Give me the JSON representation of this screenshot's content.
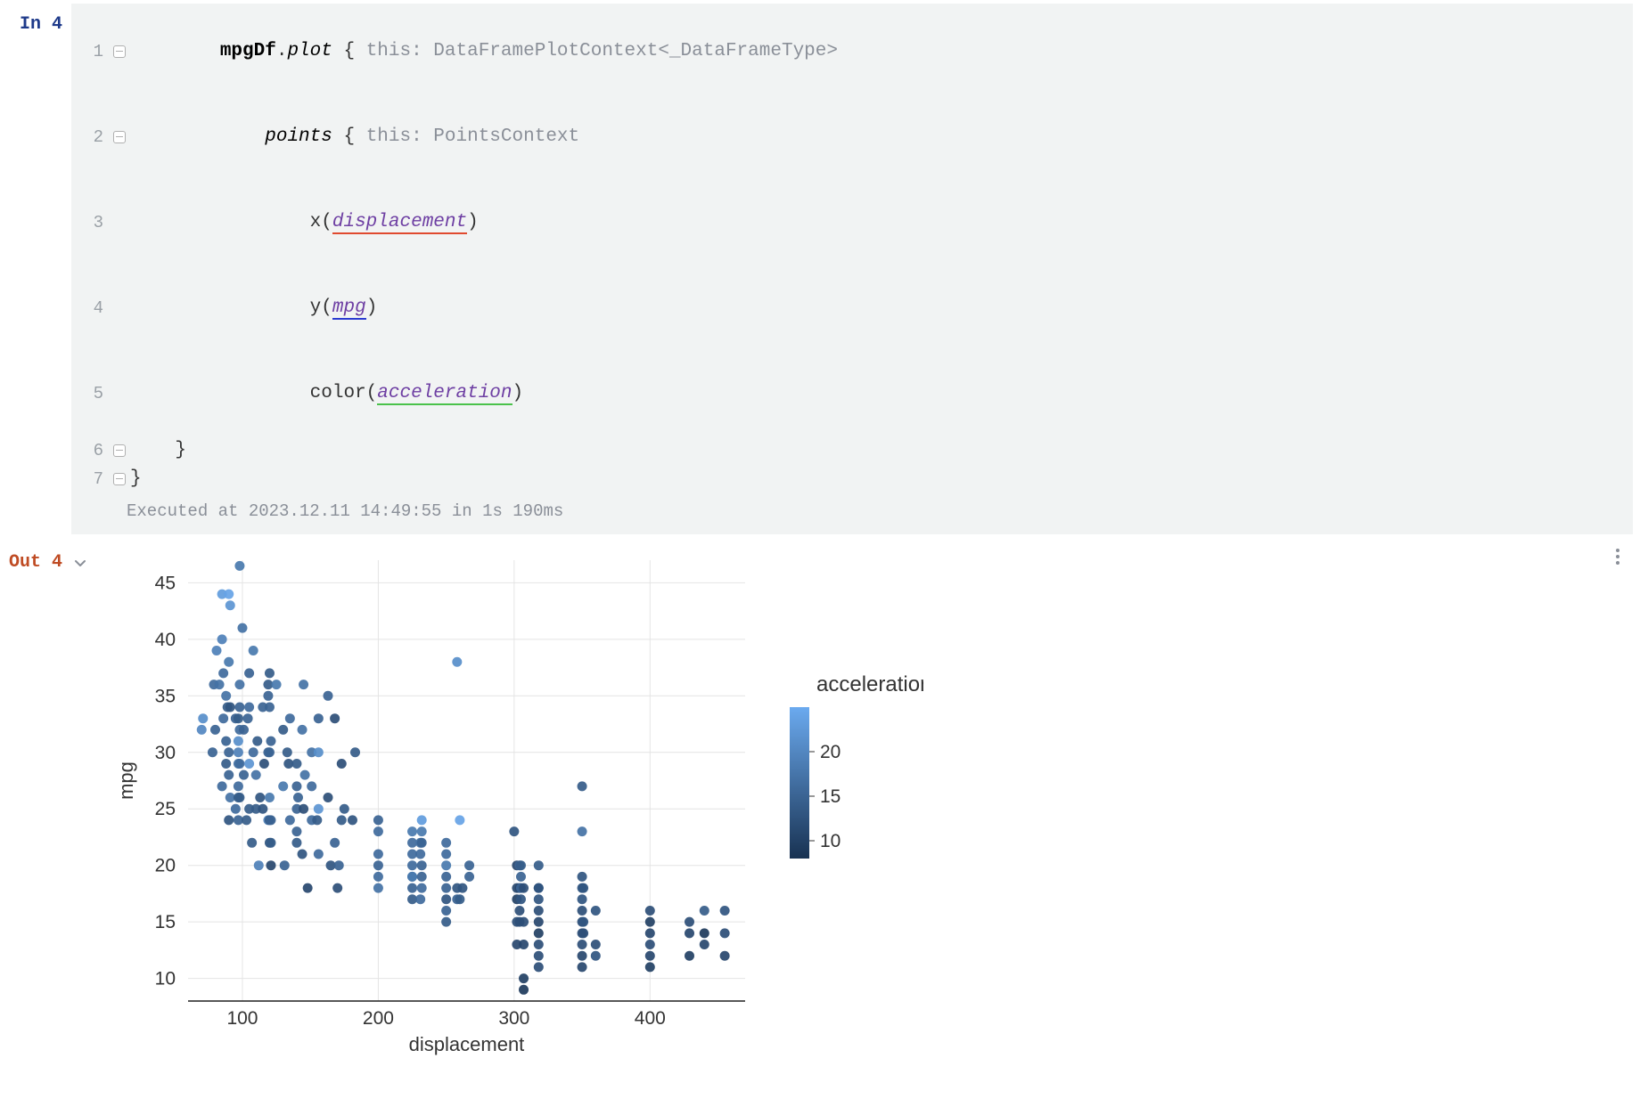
{
  "cell": {
    "in_label": "In 4",
    "out_label": "Out 4",
    "exec_info": "Executed at 2023.12.11 14:49:55 in 1s 190ms",
    "code": {
      "line1_var": "mpgDf",
      "line1_dot": ".",
      "line1_plot": "plot",
      "line1_brace": " { ",
      "line1_hint": "this: DataFramePlotContext<_DataFrameType>",
      "line2_indent": "    ",
      "line2_points": "points",
      "line2_brace": " { ",
      "line2_hint": "this: PointsContext",
      "line3_indent": "        ",
      "line3_pre": "x(",
      "line3_arg": "displacement",
      "line3_post": ")",
      "line4_indent": "        ",
      "line4_pre": "y(",
      "line4_arg": "mpg",
      "line4_post": ")",
      "line5_indent": "        ",
      "line5_pre": "color(",
      "line5_arg": "acceleration",
      "line5_post": ")",
      "line6_indent": "    ",
      "line6": "}",
      "line7": "}"
    },
    "line_numbers": [
      "1",
      "2",
      "3",
      "4",
      "5",
      "6",
      "7"
    ]
  },
  "chart_data": {
    "type": "scatter",
    "xlabel": "displacement",
    "ylabel": "mpg",
    "legend_title": "acceleration",
    "xlim": [
      60,
      470
    ],
    "ylim": [
      8,
      47
    ],
    "x_ticks": [
      100,
      200,
      300,
      400
    ],
    "y_ticks": [
      10,
      15,
      20,
      25,
      30,
      35,
      40,
      45
    ],
    "color_scale_domain": [
      8,
      25
    ],
    "color_scale_range_low": "#183252",
    "color_scale_range_high": "#6baaef",
    "legend_ticks": [
      10,
      15,
      20
    ],
    "points": [
      {
        "x": 98,
        "y": 46.5,
        "c": 18
      },
      {
        "x": 70,
        "y": 32,
        "c": 20
      },
      {
        "x": 71,
        "y": 33,
        "c": 21
      },
      {
        "x": 78,
        "y": 30,
        "c": 15
      },
      {
        "x": 79,
        "y": 36,
        "c": 16
      },
      {
        "x": 80,
        "y": 32,
        "c": 15
      },
      {
        "x": 81,
        "y": 39,
        "c": 19
      },
      {
        "x": 83,
        "y": 36,
        "c": 17
      },
      {
        "x": 85,
        "y": 27,
        "c": 16
      },
      {
        "x": 85,
        "y": 44,
        "c": 23
      },
      {
        "x": 85,
        "y": 40,
        "c": 19
      },
      {
        "x": 86,
        "y": 37,
        "c": 16
      },
      {
        "x": 86,
        "y": 33,
        "c": 16
      },
      {
        "x": 88,
        "y": 29,
        "c": 14
      },
      {
        "x": 88,
        "y": 31,
        "c": 15
      },
      {
        "x": 88,
        "y": 35,
        "c": 17
      },
      {
        "x": 89,
        "y": 34,
        "c": 14
      },
      {
        "x": 90,
        "y": 44,
        "c": 24
      },
      {
        "x": 90,
        "y": 28,
        "c": 15
      },
      {
        "x": 90,
        "y": 30,
        "c": 15
      },
      {
        "x": 90,
        "y": 38,
        "c": 18
      },
      {
        "x": 90,
        "y": 24,
        "c": 13
      },
      {
        "x": 91,
        "y": 26,
        "c": 17
      },
      {
        "x": 91,
        "y": 43,
        "c": 22
      },
      {
        "x": 91,
        "y": 34,
        "c": 13
      },
      {
        "x": 95,
        "y": 25,
        "c": 16
      },
      {
        "x": 95,
        "y": 33,
        "c": 15
      },
      {
        "x": 97,
        "y": 27,
        "c": 16
      },
      {
        "x": 97,
        "y": 29,
        "c": 17
      },
      {
        "x": 97,
        "y": 33,
        "c": 14
      },
      {
        "x": 97,
        "y": 26,
        "c": 14
      },
      {
        "x": 97,
        "y": 31,
        "c": 21
      },
      {
        "x": 97,
        "y": 30,
        "c": 19
      },
      {
        "x": 97,
        "y": 24,
        "c": 15
      },
      {
        "x": 98,
        "y": 36,
        "c": 17
      },
      {
        "x": 98,
        "y": 32,
        "c": 16
      },
      {
        "x": 98,
        "y": 26,
        "c": 14
      },
      {
        "x": 98,
        "y": 29,
        "c": 16
      },
      {
        "x": 98,
        "y": 34,
        "c": 15
      },
      {
        "x": 100,
        "y": 41,
        "c": 17
      },
      {
        "x": 101,
        "y": 28,
        "c": 15
      },
      {
        "x": 101,
        "y": 32,
        "c": 15
      },
      {
        "x": 103,
        "y": 24,
        "c": 14
      },
      {
        "x": 104,
        "y": 33,
        "c": 15
      },
      {
        "x": 105,
        "y": 37,
        "c": 15
      },
      {
        "x": 105,
        "y": 34,
        "c": 16
      },
      {
        "x": 105,
        "y": 29,
        "c": 22
      },
      {
        "x": 105,
        "y": 25,
        "c": 14
      },
      {
        "x": 107,
        "y": 22,
        "c": 14
      },
      {
        "x": 108,
        "y": 30,
        "c": 16
      },
      {
        "x": 108,
        "y": 39,
        "c": 18
      },
      {
        "x": 110,
        "y": 25,
        "c": 14
      },
      {
        "x": 110,
        "y": 28,
        "c": 17
      },
      {
        "x": 111,
        "y": 31,
        "c": 14
      },
      {
        "x": 112,
        "y": 20,
        "c": 19
      },
      {
        "x": 113,
        "y": 26,
        "c": 13
      },
      {
        "x": 115,
        "y": 25,
        "c": 13
      },
      {
        "x": 115,
        "y": 34,
        "c": 15
      },
      {
        "x": 116,
        "y": 29,
        "c": 12
      },
      {
        "x": 119,
        "y": 36,
        "c": 14
      },
      {
        "x": 119,
        "y": 35,
        "c": 15
      },
      {
        "x": 119,
        "y": 24,
        "c": 19
      },
      {
        "x": 119,
        "y": 30,
        "c": 15
      },
      {
        "x": 120,
        "y": 22,
        "c": 13
      },
      {
        "x": 120,
        "y": 34,
        "c": 15
      },
      {
        "x": 120,
        "y": 24,
        "c": 14
      },
      {
        "x": 120,
        "y": 26,
        "c": 18
      },
      {
        "x": 120,
        "y": 37,
        "c": 14
      },
      {
        "x": 120,
        "y": 30,
        "c": 15
      },
      {
        "x": 121,
        "y": 22,
        "c": 14
      },
      {
        "x": 121,
        "y": 31,
        "c": 15
      },
      {
        "x": 121,
        "y": 24,
        "c": 15
      },
      {
        "x": 121,
        "y": 20,
        "c": 11
      },
      {
        "x": 125,
        "y": 36,
        "c": 18
      },
      {
        "x": 130,
        "y": 27,
        "c": 18
      },
      {
        "x": 130,
        "y": 32,
        "c": 14
      },
      {
        "x": 131,
        "y": 20,
        "c": 15
      },
      {
        "x": 133,
        "y": 30,
        "c": 14
      },
      {
        "x": 134,
        "y": 29,
        "c": 13
      },
      {
        "x": 135,
        "y": 33,
        "c": 16
      },
      {
        "x": 135,
        "y": 24,
        "c": 16
      },
      {
        "x": 140,
        "y": 22,
        "c": 14
      },
      {
        "x": 140,
        "y": 23,
        "c": 15
      },
      {
        "x": 140,
        "y": 25,
        "c": 15
      },
      {
        "x": 140,
        "y": 27,
        "c": 15
      },
      {
        "x": 140,
        "y": 29,
        "c": 14
      },
      {
        "x": 141,
        "y": 26,
        "c": 15
      },
      {
        "x": 144,
        "y": 32,
        "c": 17
      },
      {
        "x": 144,
        "y": 21,
        "c": 13
      },
      {
        "x": 145,
        "y": 36,
        "c": 17
      },
      {
        "x": 145,
        "y": 25,
        "c": 12
      },
      {
        "x": 146,
        "y": 28,
        "c": 17
      },
      {
        "x": 148,
        "y": 18,
        "c": 11
      },
      {
        "x": 151,
        "y": 27,
        "c": 16
      },
      {
        "x": 151,
        "y": 30,
        "c": 17
      },
      {
        "x": 151,
        "y": 24,
        "c": 16
      },
      {
        "x": 155,
        "y": 24,
        "c": 14
      },
      {
        "x": 156,
        "y": 30,
        "c": 21
      },
      {
        "x": 156,
        "y": 25,
        "c": 22
      },
      {
        "x": 156,
        "y": 21,
        "c": 16
      },
      {
        "x": 156,
        "y": 33,
        "c": 15
      },
      {
        "x": 163,
        "y": 26,
        "c": 12
      },
      {
        "x": 163,
        "y": 35,
        "c": 15
      },
      {
        "x": 165,
        "y": 20,
        "c": 13
      },
      {
        "x": 168,
        "y": 22,
        "c": 15
      },
      {
        "x": 168,
        "y": 33,
        "c": 12
      },
      {
        "x": 170,
        "y": 18,
        "c": 12
      },
      {
        "x": 171,
        "y": 20,
        "c": 15
      },
      {
        "x": 173,
        "y": 24,
        "c": 14
      },
      {
        "x": 173,
        "y": 29,
        "c": 12
      },
      {
        "x": 175,
        "y": 25,
        "c": 14
      },
      {
        "x": 181,
        "y": 24,
        "c": 13
      },
      {
        "x": 183,
        "y": 30,
        "c": 14
      },
      {
        "x": 200,
        "y": 23,
        "c": 16
      },
      {
        "x": 200,
        "y": 20,
        "c": 15
      },
      {
        "x": 200,
        "y": 24,
        "c": 15
      },
      {
        "x": 200,
        "y": 19,
        "c": 16
      },
      {
        "x": 200,
        "y": 21,
        "c": 16
      },
      {
        "x": 200,
        "y": 18,
        "c": 17
      },
      {
        "x": 225,
        "y": 18,
        "c": 15
      },
      {
        "x": 225,
        "y": 19,
        "c": 17
      },
      {
        "x": 225,
        "y": 21,
        "c": 16
      },
      {
        "x": 225,
        "y": 17,
        "c": 14
      },
      {
        "x": 225,
        "y": 22,
        "c": 16
      },
      {
        "x": 225,
        "y": 20,
        "c": 16
      },
      {
        "x": 225,
        "y": 23,
        "c": 18
      },
      {
        "x": 225,
        "y": 19,
        "c": 18
      },
      {
        "x": 231,
        "y": 17,
        "c": 16
      },
      {
        "x": 231,
        "y": 22,
        "c": 17
      },
      {
        "x": 231,
        "y": 21,
        "c": 16
      },
      {
        "x": 232,
        "y": 24,
        "c": 23
      },
      {
        "x": 232,
        "y": 20,
        "c": 15
      },
      {
        "x": 232,
        "y": 22,
        "c": 15
      },
      {
        "x": 232,
        "y": 19,
        "c": 15
      },
      {
        "x": 232,
        "y": 18,
        "c": 16
      },
      {
        "x": 232,
        "y": 23,
        "c": 18
      },
      {
        "x": 250,
        "y": 18,
        "c": 15
      },
      {
        "x": 250,
        "y": 17,
        "c": 13
      },
      {
        "x": 250,
        "y": 21,
        "c": 16
      },
      {
        "x": 250,
        "y": 22,
        "c": 16
      },
      {
        "x": 250,
        "y": 19,
        "c": 15
      },
      {
        "x": 250,
        "y": 16,
        "c": 15
      },
      {
        "x": 250,
        "y": 15,
        "c": 14
      },
      {
        "x": 250,
        "y": 20,
        "c": 18
      },
      {
        "x": 258,
        "y": 38,
        "c": 21
      },
      {
        "x": 258,
        "y": 18,
        "c": 13
      },
      {
        "x": 258,
        "y": 17,
        "c": 15
      },
      {
        "x": 260,
        "y": 24,
        "c": 24
      },
      {
        "x": 260,
        "y": 17,
        "c": 14
      },
      {
        "x": 262,
        "y": 18,
        "c": 13
      },
      {
        "x": 267,
        "y": 19,
        "c": 15
      },
      {
        "x": 267,
        "y": 20,
        "c": 15
      },
      {
        "x": 300,
        "y": 23,
        "c": 13
      },
      {
        "x": 302,
        "y": 20,
        "c": 11
      },
      {
        "x": 302,
        "y": 18,
        "c": 11
      },
      {
        "x": 302,
        "y": 13,
        "c": 11
      },
      {
        "x": 302,
        "y": 17,
        "c": 10
      },
      {
        "x": 302,
        "y": 15,
        "c": 12
      },
      {
        "x": 304,
        "y": 16,
        "c": 12
      },
      {
        "x": 304,
        "y": 20,
        "c": 15
      },
      {
        "x": 304,
        "y": 15,
        "c": 12
      },
      {
        "x": 304,
        "y": 18,
        "c": 11
      },
      {
        "x": 305,
        "y": 20,
        "c": 14
      },
      {
        "x": 305,
        "y": 17,
        "c": 13
      },
      {
        "x": 305,
        "y": 19,
        "c": 15
      },
      {
        "x": 305,
        "y": 18,
        "c": 15
      },
      {
        "x": 307,
        "y": 18,
        "c": 12
      },
      {
        "x": 307,
        "y": 15,
        "c": 12
      },
      {
        "x": 307,
        "y": 9,
        "c": 9
      },
      {
        "x": 307,
        "y": 10,
        "c": 10
      },
      {
        "x": 307,
        "y": 13,
        "c": 11
      },
      {
        "x": 318,
        "y": 15,
        "c": 11
      },
      {
        "x": 318,
        "y": 18,
        "c": 11
      },
      {
        "x": 318,
        "y": 13,
        "c": 12
      },
      {
        "x": 318,
        "y": 17,
        "c": 13
      },
      {
        "x": 318,
        "y": 14,
        "c": 10
      },
      {
        "x": 318,
        "y": 16,
        "c": 12
      },
      {
        "x": 318,
        "y": 18,
        "c": 13
      },
      {
        "x": 318,
        "y": 20,
        "c": 14
      },
      {
        "x": 318,
        "y": 11,
        "c": 12
      },
      {
        "x": 318,
        "y": 12,
        "c": 12
      },
      {
        "x": 350,
        "y": 27,
        "c": 14
      },
      {
        "x": 350,
        "y": 14,
        "c": 12
      },
      {
        "x": 350,
        "y": 13,
        "c": 12
      },
      {
        "x": 350,
        "y": 15,
        "c": 12
      },
      {
        "x": 350,
        "y": 17,
        "c": 13
      },
      {
        "x": 350,
        "y": 16,
        "c": 12
      },
      {
        "x": 350,
        "y": 18,
        "c": 13
      },
      {
        "x": 350,
        "y": 12,
        "c": 11
      },
      {
        "x": 350,
        "y": 19,
        "c": 13
      },
      {
        "x": 350,
        "y": 23,
        "c": 17
      },
      {
        "x": 350,
        "y": 11,
        "c": 11
      },
      {
        "x": 351,
        "y": 15,
        "c": 13
      },
      {
        "x": 351,
        "y": 18,
        "c": 13
      },
      {
        "x": 351,
        "y": 14,
        "c": 12
      },
      {
        "x": 360,
        "y": 16,
        "c": 13
      },
      {
        "x": 360,
        "y": 13,
        "c": 12
      },
      {
        "x": 360,
        "y": 12,
        "c": 13
      },
      {
        "x": 400,
        "y": 15,
        "c": 10
      },
      {
        "x": 400,
        "y": 11,
        "c": 10
      },
      {
        "x": 400,
        "y": 16,
        "c": 12
      },
      {
        "x": 400,
        "y": 14,
        "c": 11
      },
      {
        "x": 400,
        "y": 12,
        "c": 11
      },
      {
        "x": 400,
        "y": 13,
        "c": 12
      },
      {
        "x": 429,
        "y": 12,
        "c": 10
      },
      {
        "x": 429,
        "y": 14,
        "c": 11
      },
      {
        "x": 429,
        "y": 15,
        "c": 12
      },
      {
        "x": 440,
        "y": 16,
        "c": 14
      },
      {
        "x": 440,
        "y": 14,
        "c": 9
      },
      {
        "x": 440,
        "y": 13,
        "c": 11
      },
      {
        "x": 455,
        "y": 14,
        "c": 12
      },
      {
        "x": 455,
        "y": 12,
        "c": 11
      },
      {
        "x": 455,
        "y": 16,
        "c": 13
      }
    ]
  }
}
